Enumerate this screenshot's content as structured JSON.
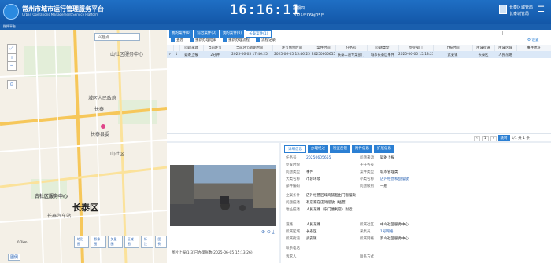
{
  "header": {
    "title": "常州市城市运行管理服务平台",
    "subtitle": "Urban Operations Management Service Platform",
    "clock": "16:16:11",
    "weekday": "星期四",
    "date": "2025年06月05日",
    "user_name": "长泰区城管局",
    "user_role": "长泰城管局"
  },
  "subbar": {
    "label": "指挥平台"
  },
  "map": {
    "search_placeholder": "兴趣点",
    "controls": [
      "⤢",
      "+",
      "−",
      "⊙"
    ],
    "labels": [
      "山社区服务中心",
      "城区人民政府",
      "长泰",
      "长泰县委",
      "长泰区",
      "古社区服务中心",
      "山社区",
      "长泰汽车站"
    ],
    "district": "长泰区",
    "buttons": [
      "地形图",
      "影像图",
      "矢量图",
      "区域图",
      "标注",
      "图例"
    ],
    "scale": "0.2km",
    "footer": "图例"
  },
  "case_tabs": [
    {
      "label": "我的案件(0)",
      "active": false
    },
    {
      "label": "综合案件(0)",
      "active": false
    },
    {
      "label": "我的案件(0)",
      "active": false
    },
    {
      "label": "长泰案件(1)",
      "active": true
    }
  ],
  "toolbar": [
    "查办",
    "重新办理结束",
    "重新办理流程",
    "流程记录"
  ],
  "settings_label": "设置",
  "table": {
    "headers": [
      "",
      "",
      "问题来源",
      "当前环节",
      "当前环节到期时间",
      "环节剩余时间",
      "案件时间",
      "任务号",
      "问题类型",
      "专业部门",
      "上报时间",
      "所属街道",
      "所属区域",
      "事件地址"
    ],
    "rows": [
      [
        "✓",
        "1",
        "疑难上报",
        "2分钟",
        "2025-06-05 17:46:25",
        "2025-06-05 15:46:25",
        "20250605655",
        "长泰二道专案部门",
        "城市长泰区事件",
        "2025-06-05 15:13:25",
        "武安镇",
        "长泰区",
        "人民东路"
      ]
    ]
  },
  "pager": {
    "prev": "‹",
    "next": "›",
    "page": "1",
    "go": "跳转",
    "total": "1/1 共 1 条"
  },
  "photo": {
    "caption": "图片上报(1-3)已办理张数(2025-06-05 15:13:26)",
    "tools": "⊕ ⊖ ⤓"
  },
  "detail": {
    "tabs": [
      {
        "label": "详细信息",
        "active": true
      },
      {
        "label": "办理经过",
        "active": false
      },
      {
        "label": "检查反馈",
        "active": false
      },
      {
        "label": "附件信息",
        "active": false
      },
      {
        "label": "扩展信息",
        "active": false
      }
    ],
    "fields": [
      {
        "k": "任务号",
        "v": "20250605655",
        "link": true
      },
      {
        "k": "问题来源",
        "v": "疑难上报"
      },
      {
        "k": "处置时限",
        "v": ""
      },
      {
        "k": "子任务号",
        "v": ""
      },
      {
        "k": "问题类型",
        "v": "事件"
      },
      {
        "k": "案件类型",
        "v": "城市管理类"
      },
      {
        "k": "大类名称",
        "v": "市容环境"
      },
      {
        "k": "小类名称",
        "v": "店外经营和乱摆放"
      },
      {
        "k": "部件编码",
        "v": ""
      },
      {
        "k": "问题级别",
        "v": "一般"
      },
      {
        "k": "立案条件",
        "v": "店外经营区域商铺超出门窗摆卖"
      },
      {
        "k": "问题描述",
        "v": "有店家在店外摆放（经营）"
      },
      {
        "k": "地址描述",
        "v": "人民东路（东门便利店）附近"
      },
      {
        "k": "道路",
        "v": "人民东路"
      },
      {
        "k": "所属区域",
        "v": "长泰区"
      },
      {
        "k": "所属街道",
        "v": "武安镇"
      },
      {
        "k": "所属社区",
        "v": "中山社区服务中心"
      },
      {
        "k": "采集员",
        "v": "1号网格",
        "link": true
      },
      {
        "k": "所属网格",
        "v": "罗山社区服务中心"
      },
      {
        "k": "联系电话",
        "v": ""
      },
      {
        "k": "诉求人",
        "v": ""
      },
      {
        "k": "联系方式",
        "v": ""
      }
    ]
  },
  "colors": {
    "primary": "#2b7fd3",
    "header": "#1357a8",
    "link": "#2a63b3"
  }
}
